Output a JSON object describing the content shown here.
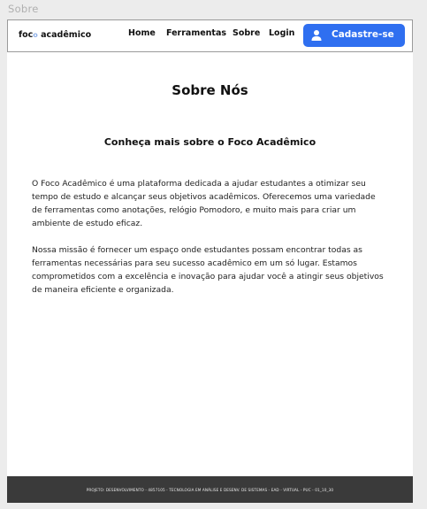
{
  "frame": {
    "label": "Sobre"
  },
  "navbar": {
    "logo_prefix": "foc",
    "logo_mark": "o",
    "logo_suffix": " acadêmico",
    "links": {
      "home": "Home",
      "tools": "Ferramentas",
      "about": "Sobre",
      "login": "Login"
    },
    "signup_label": "Cadastre-se",
    "signup_icon": "user-icon",
    "accent_color": "#2f6ff0"
  },
  "main": {
    "title": "Sobre Nós",
    "subtitle": "Conheça mais sobre o Foco Acadêmico",
    "paragraph1": "O Foco Acadêmico é uma plataforma dedicada a ajudar estudantes a otimizar seu tempo de estudo e alcançar seus objetivos acadêmicos. Oferecemos uma variedade de ferramentas como anotações, relógio Pomodoro, e muito mais para criar um ambiente de estudo eficaz.",
    "paragraph2": "Nossa missão é fornecer um espaço onde estudantes possam encontrar todas as ferramentas necessárias para seu sucesso acadêmico em um só lugar. Estamos comprometidos com a excelência e inovação para ajudar você a atingir seus objetivos de maneira eficiente e organizada."
  },
  "footer": {
    "text": "PROJETO: DESENVOLVIMENTO - 4857105 - TECNOLOGIA EM ANÁLISE E DESENV. DE SISTEMAS - EAD - VIRTUAL - PUC - 01_10_30"
  }
}
